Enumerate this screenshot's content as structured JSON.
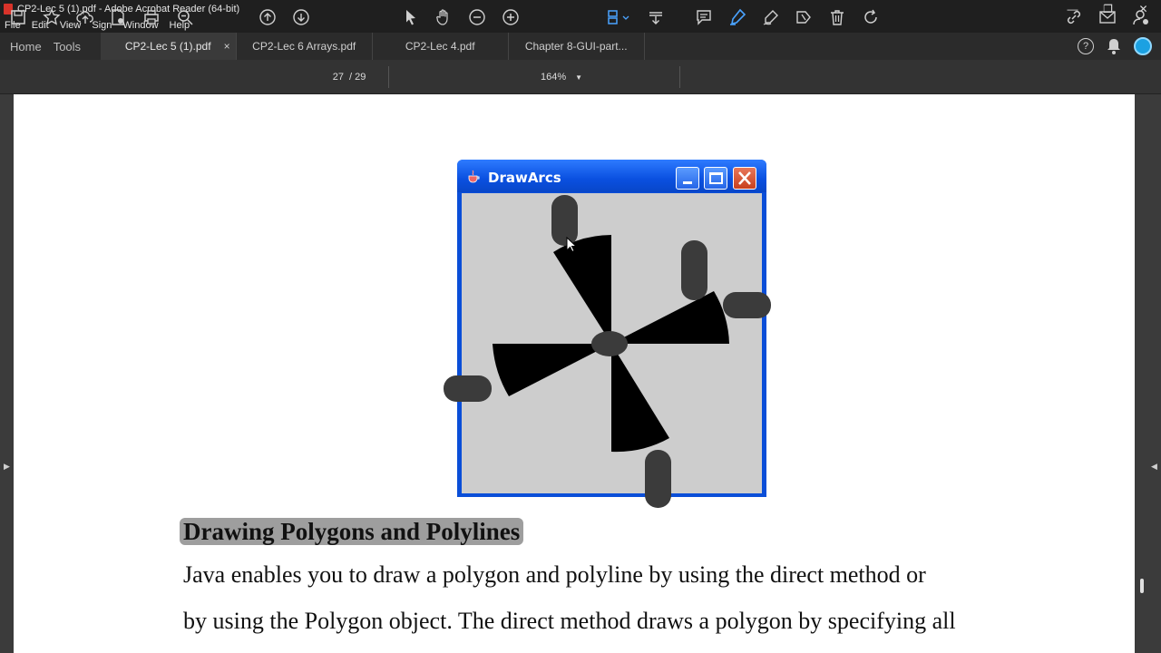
{
  "window": {
    "title": "CP2-Lec 5 (1).pdf - Adobe Acrobat Reader (64-bit)",
    "controls": [
      "minimize-icon",
      "restore-icon",
      "close-icon"
    ]
  },
  "menu": [
    "File",
    "Edit",
    "View",
    "Sign",
    "Window",
    "Help"
  ],
  "nav": {
    "home": "Home",
    "tools": "Tools"
  },
  "tabs": [
    {
      "label": "CP2-Lec 5 (1).pdf",
      "active": true,
      "close": "×"
    },
    {
      "label": "CP2-Lec 6 Arrays.pdf",
      "active": false
    },
    {
      "label": "CP2-Lec 4.pdf",
      "active": false
    },
    {
      "label": "Chapter 8-GUI-part...",
      "active": false
    }
  ],
  "toolbar": {
    "page_current": "27",
    "page_total": "/  29",
    "zoom": "164%",
    "highlight_color": "#4aa3ff"
  },
  "java_window": {
    "title": "DrawArcs",
    "client_bg": "#cdcdcd",
    "frame_color": "#0a4ed8"
  },
  "document": {
    "heading": "Drawing Polygons and Polylines",
    "line1": "Java enables you to draw a polygon and  polyline by using the direct method or",
    "line2": "by using the Polygon object. The direct method draws a polygon by specifying all"
  }
}
